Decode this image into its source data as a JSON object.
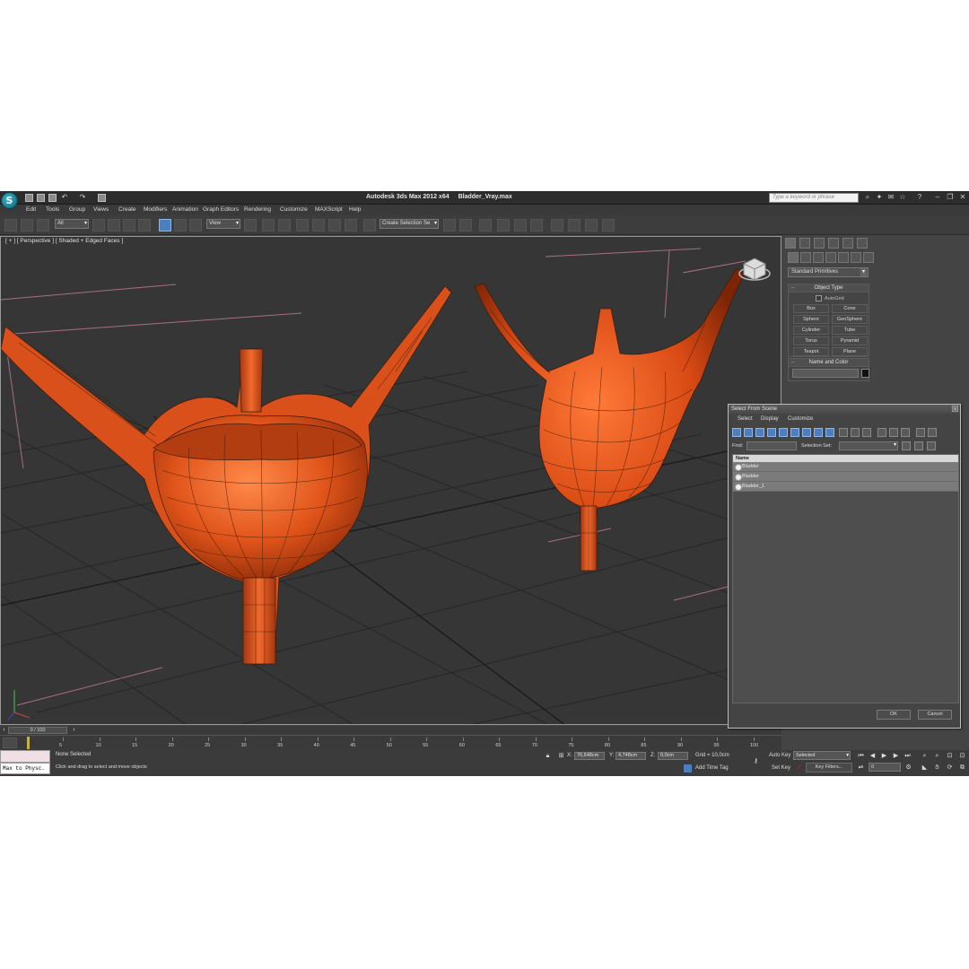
{
  "app": {
    "title": "Autodesk 3ds Max  2012 x64",
    "file": "Bladder_Vray.max",
    "logo_letter": "S",
    "help_search_placeholder": "Type a keyword or phrase"
  },
  "menu": [
    "Edit",
    "Tools",
    "Group",
    "Views",
    "Create",
    "Modifiers",
    "Animation",
    "Graph Editors",
    "Rendering",
    "Customize",
    "MAXScript",
    "Help"
  ],
  "toolbar": {
    "selection_filter": "All",
    "ref_coord": "View",
    "named_selection": "Create Selection Se"
  },
  "viewport": {
    "label": "[ + ] [ Perspective ] [ Shaded + Edged Faces ]",
    "objects": [
      "bladder-section-model",
      "bladder-model"
    ],
    "colors": {
      "background": "#363636",
      "grid": "#232323",
      "mesh": "#e35a1e",
      "wire": "#3a1a0a"
    }
  },
  "command_panel": {
    "category": "Standard Primitives",
    "object_type_title": "Object Type",
    "autogrid": "AutoGrid",
    "primitives": [
      "Box",
      "Cone",
      "Sphere",
      "GeoSphere",
      "Cylinder",
      "Tube",
      "Torus",
      "Pyramid",
      "Teapot",
      "Plane"
    ],
    "name_color_title": "Name and Color"
  },
  "dialog": {
    "title": "Select From Scene",
    "close": "x",
    "menu": [
      "Select",
      "Display",
      "Customize"
    ],
    "find_label": "Find:",
    "selection_set_label": "Selection Set:",
    "column_name": "Name",
    "rows": [
      "Bladder",
      "Bladder",
      "Bladder_1"
    ],
    "ok": "OK",
    "cancel": "Cancel"
  },
  "timeline": {
    "slider": "0 / 100",
    "ticks": [
      "5",
      "10",
      "15",
      "20",
      "25",
      "30",
      "35",
      "40",
      "45",
      "50",
      "55",
      "60",
      "65",
      "70",
      "75",
      "80",
      "85",
      "90",
      "95",
      "100"
    ]
  },
  "status": {
    "maxscript": "Max to Physc.",
    "selection": "None Selected",
    "prompt": "Click and drag to select and move objects",
    "x": "76,648cm",
    "y": "4,748cm",
    "z": "0,0cm",
    "grid": "Grid = 10,0cm",
    "add_time_tag": "Add Time Tag",
    "auto_key": "Auto Key",
    "key_mode": "Selected",
    "set_key": "Set Key",
    "key_filters": "Key Filters...",
    "frame": "0"
  }
}
